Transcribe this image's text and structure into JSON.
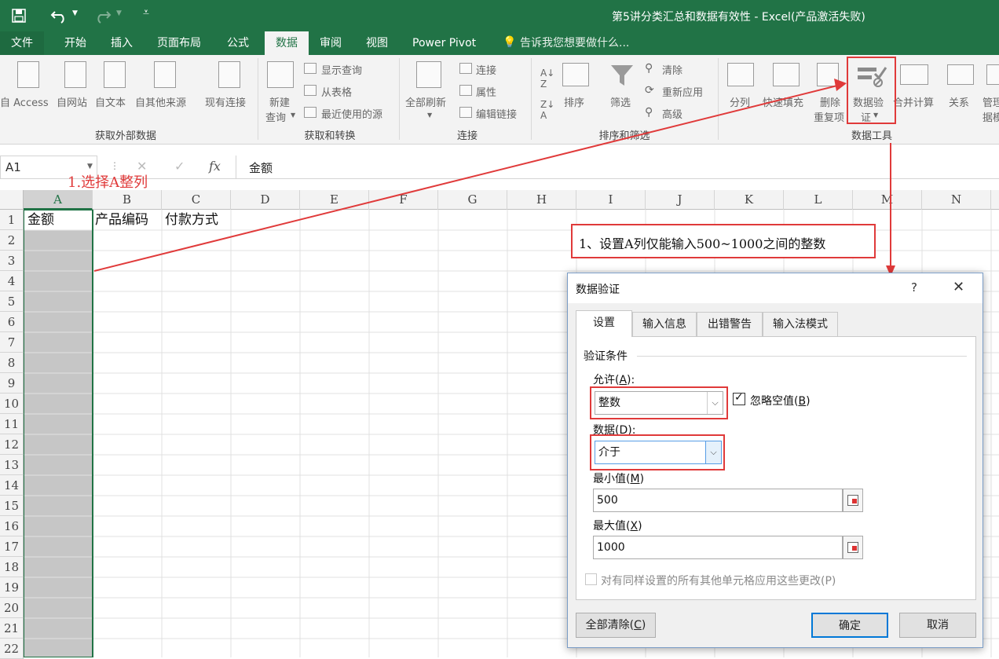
{
  "title_bar": {
    "text": "第5讲分类汇总和数据有效性 - Excel(产品激活失败)",
    "save_icon": "save-icon",
    "undo_icon": "undo-icon",
    "redo_icon": "redo-icon",
    "customize_icon": "customize-qat-icon"
  },
  "tabs": [
    "文件",
    "开始",
    "插入",
    "页面布局",
    "公式",
    "数据",
    "审阅",
    "视图",
    "Power Pivot"
  ],
  "active_tab": "数据",
  "tell_me": "告诉我您想要做什么...",
  "ribbon": {
    "get_external": {
      "access": "自 Access",
      "web": "自网站",
      "text": "自文本",
      "other": "自其他来源",
      "existing": "现有连接",
      "group": "获取外部数据"
    },
    "get_transform": {
      "new_query_1": "新建",
      "new_query_2": "查询",
      "show_query": "显示查询",
      "from_table": "从表格",
      "recent_sources": "最近使用的源",
      "group": "获取和转换"
    },
    "connections": {
      "refresh_all": "全部刷新",
      "connections": "连接",
      "properties": "属性",
      "edit_links": "编辑链接",
      "group": "连接"
    },
    "sort_filter": {
      "sort": "排序",
      "filter": "筛选",
      "clear": "清除",
      "reapply": "重新应用",
      "advanced": "高级",
      "group": "排序和筛选"
    },
    "data_tools": {
      "text_to_columns": "分列",
      "flash_fill": "快速填充",
      "remove_dup_1": "删除",
      "remove_dup_2": "重复项",
      "validation_1": "数据验",
      "validation_2": "证",
      "consolidate": "合并计算",
      "relationships": "关系",
      "manage_1": "管理",
      "manage_2": "据模",
      "group": "数据工具"
    }
  },
  "formula_bar": {
    "name_box": "A1",
    "fx": "fx",
    "content": "金额"
  },
  "columns": [
    "A",
    "B",
    "C",
    "D",
    "E",
    "F",
    "G",
    "H",
    "I",
    "J",
    "K",
    "L",
    "M",
    "N"
  ],
  "rows": [
    "1",
    "2",
    "3",
    "4",
    "5",
    "6",
    "7",
    "8",
    "9",
    "10",
    "11",
    "12",
    "13",
    "14",
    "15",
    "16",
    "17",
    "18",
    "19",
    "20",
    "21",
    "22"
  ],
  "cells": {
    "A1": "金额",
    "B1": "产品编码",
    "C1": "付款方式"
  },
  "annotations": {
    "step1": "1.选择A整列",
    "instruction": "1、设置A列仅能输入500~1000之间的整数"
  },
  "dialog": {
    "title": "数据验证",
    "help": "?",
    "close_icon": "close-icon",
    "tabs": [
      "设置",
      "输入信息",
      "出错警告",
      "输入法模式"
    ],
    "active_tab": "设置",
    "section": "验证条件",
    "allow_label": "允许(A):",
    "allow_value": "整数",
    "ignore_blank": "忽略空值(B)",
    "ignore_blank_checked": true,
    "data_label": "数据(D):",
    "data_value": "介于",
    "min_label": "最小值(M)",
    "min_value": "500",
    "max_label": "最大值(X)",
    "max_value": "1000",
    "apply_all": "对有同样设置的所有其他单元格应用这些更改(P)",
    "clear_all": "全部清除(C)",
    "ok": "确定",
    "cancel": "取消"
  },
  "colors": {
    "excel_green": "#217346",
    "annotation_red": "#e03a3a",
    "selected_column": "#c6c6c6"
  }
}
